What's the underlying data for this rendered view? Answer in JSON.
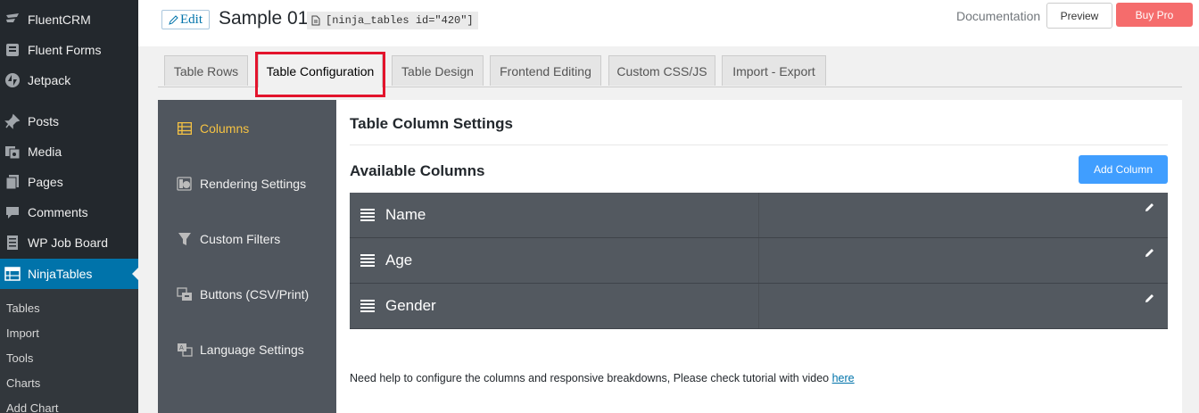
{
  "wp_menu": {
    "items": [
      {
        "label": "FluentCRM",
        "icon": "fluentcrm-icon"
      },
      {
        "label": "Fluent Forms",
        "icon": "fluent-forms-icon"
      },
      {
        "label": "Jetpack",
        "icon": "jetpack-icon"
      },
      {
        "label": "Posts",
        "icon": "pin-icon"
      },
      {
        "label": "Media",
        "icon": "media-icon"
      },
      {
        "label": "Pages",
        "icon": "pages-icon"
      },
      {
        "label": "Comments",
        "icon": "comment-icon"
      },
      {
        "label": "WP Job Board",
        "icon": "list-icon"
      },
      {
        "label": "NinjaTables",
        "icon": "table-icon",
        "active": true
      }
    ],
    "submenu": [
      "Tables",
      "Import",
      "Tools",
      "Charts",
      "Add Chart"
    ]
  },
  "header": {
    "edit_label": "Edit",
    "title": "Sample 01",
    "shortcode": "[ninja_tables id=\"420\"]",
    "documentation_label": "Documentation",
    "preview_label": "Preview",
    "buy_pro_label": "Buy Pro"
  },
  "tabs": [
    {
      "label": "Table Rows"
    },
    {
      "label": "Table Configuration",
      "active": true
    },
    {
      "label": "Table Design"
    },
    {
      "label": "Frontend Editing"
    },
    {
      "label": "Custom CSS/JS"
    },
    {
      "label": "Import - Export"
    }
  ],
  "settings_nav": [
    {
      "label": "Columns",
      "icon": "columns-icon",
      "active": true
    },
    {
      "label": "Rendering Settings",
      "icon": "rendering-icon"
    },
    {
      "label": "Custom Filters",
      "icon": "filter-icon"
    },
    {
      "label": "Buttons (CSV/Print)",
      "icon": "buttons-icon"
    },
    {
      "label": "Language Settings",
      "icon": "language-icon"
    }
  ],
  "main": {
    "settings_title": "Table Column Settings",
    "available_title": "Available Columns",
    "add_column_label": "Add Column",
    "columns": [
      {
        "name": "Name"
      },
      {
        "name": "Age"
      },
      {
        "name": "Gender"
      }
    ],
    "help_text": "Need help to configure the columns and responsive breakdowns, Please check tutorial with video",
    "help_link": "here"
  },
  "colors": {
    "wp_sidebar": "#23282d",
    "wp_active": "#0073aa",
    "nav_bg": "#50565e",
    "nav_active": "#f5c243",
    "column_row": "#535960",
    "add_button": "#409eff",
    "buy_pro": "#f56c6c",
    "highlight": "#e3142c"
  }
}
